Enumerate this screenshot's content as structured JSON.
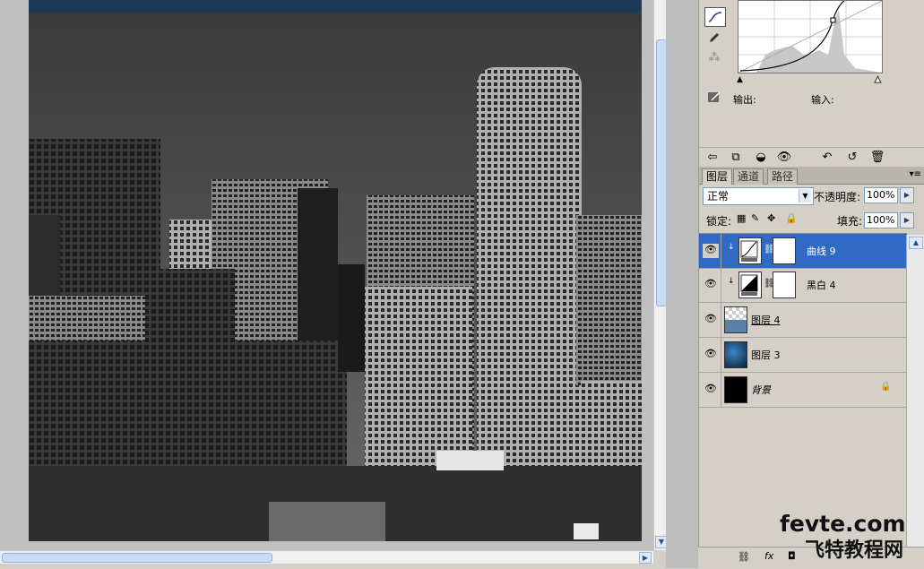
{
  "adjustments": {
    "output_label": "输出:",
    "input_label": "输入:"
  },
  "layers_panel": {
    "tabs": [
      "图层",
      "通道",
      "路径"
    ],
    "blend_mode": "正常",
    "opacity_label": "不透明度:",
    "opacity_value": "100%",
    "lock_label": "锁定:",
    "fill_label": "填充:",
    "fill_value": "100%",
    "layers": [
      {
        "name": "曲线 9",
        "selected": true
      },
      {
        "name": "黑白 4",
        "selected": false
      },
      {
        "name": "图层 4",
        "selected": false
      },
      {
        "name": "图层 3",
        "selected": false
      },
      {
        "name": "背景",
        "selected": false
      }
    ]
  },
  "watermark": {
    "line1": "fevte.com",
    "line2": "飞特教程网"
  },
  "colors": {
    "selection": "#316ac5",
    "panel_bg": "#d4d0c8"
  }
}
